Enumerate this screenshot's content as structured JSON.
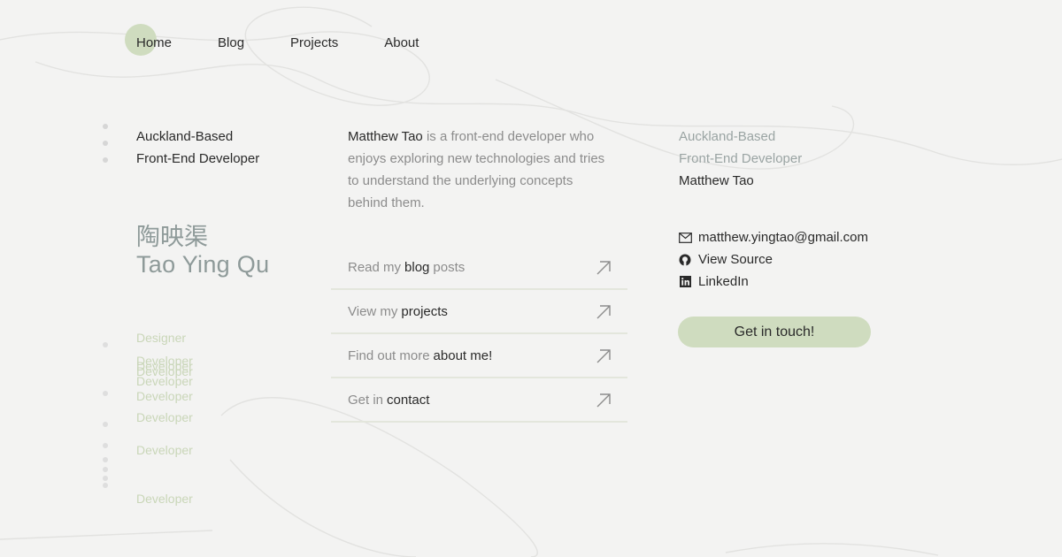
{
  "nav": {
    "items": [
      {
        "label": "Home"
      },
      {
        "label": "Blog"
      },
      {
        "label": "Projects"
      },
      {
        "label": "About"
      }
    ]
  },
  "left": {
    "tagline_line1": "Auckland-Based",
    "tagline_line2": "Front-End Developer",
    "name_cn": "陶映渠",
    "name_en": "Tao Ying Qu",
    "roles": [
      "Designer",
      "Developer",
      "Developer",
      "Developer",
      "Developer",
      "Developer",
      "Developer",
      "Developer",
      "Developer"
    ]
  },
  "bio": {
    "name": "Matthew Tao",
    "text": " is a front-end developer who enjoys exploring new technologies and tries to understand the underlying concepts behind them."
  },
  "links": [
    {
      "prefix": "Read my",
      "highlight": "blog",
      "suffix": "posts"
    },
    {
      "prefix": "View my",
      "highlight": "projects",
      "suffix": ""
    },
    {
      "prefix": "Find out more",
      "highlight": "about me!",
      "suffix": ""
    },
    {
      "prefix": "Get in",
      "highlight": "contact",
      "suffix": ""
    }
  ],
  "right": {
    "tagline_line1": "Auckland-Based",
    "tagline_line2": "Front-End Developer",
    "name": "Matthew Tao",
    "contacts": [
      {
        "icon": "mail-icon",
        "label": "matthew.yingtao@gmail.com"
      },
      {
        "icon": "github-icon",
        "label": "View Source"
      },
      {
        "icon": "linkedin-icon",
        "label": "LinkedIn"
      }
    ],
    "cta_label": "Get in touch!"
  },
  "colors": {
    "accent": "#cfdcbf",
    "muted_text": "#8c8c8c",
    "name_color": "#8e9a99",
    "role_color": "#c9d6b8",
    "background": "#f3f3f2"
  }
}
